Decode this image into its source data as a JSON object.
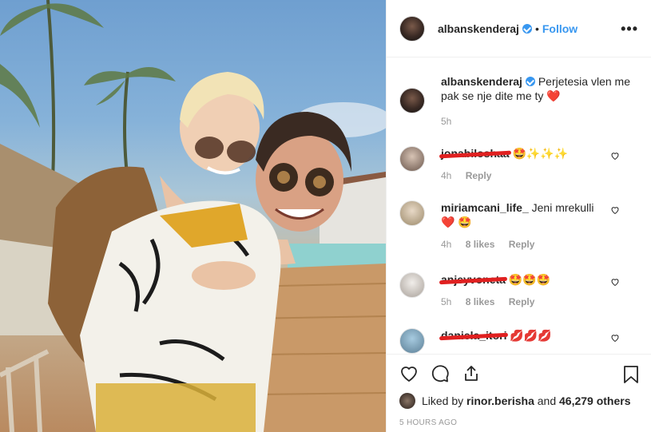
{
  "header": {
    "username": "albanskenderaj",
    "separator": "•",
    "follow_label": "Follow",
    "more_label": "•••"
  },
  "caption": {
    "username": "albanskenderaj",
    "text": "Perjetesia vlen me pak se nje dite me ty",
    "emoji": "❤️",
    "time": "5h"
  },
  "comments": [
    {
      "username": "jonabiloshaa",
      "text": "🤩✨✨✨",
      "time": "4h",
      "likes": "",
      "reply": "Reply",
      "struck": true
    },
    {
      "username": "miriamcani_life_",
      "text": "Jeni mrekulli❤️ 🤩",
      "time": "4h",
      "likes": "8 likes",
      "reply": "Reply",
      "struck": false
    },
    {
      "username": "anjeyvoneta",
      "text": "🤩🤩🤩",
      "time": "5h",
      "likes": "8 likes",
      "reply": "Reply",
      "struck": true
    },
    {
      "username": "daniela_itori",
      "text": "💋💋💋",
      "time": "",
      "likes": "",
      "reply": "",
      "struck": true
    }
  ],
  "likes_line": {
    "prefix": "Liked by",
    "user": "rinor.berisha",
    "middle": "and",
    "count": "46,279 others"
  },
  "timestamp": "5 HOURS AGO",
  "colors": {
    "link": "#3897f0",
    "muted": "#999999",
    "verified": "#3897f0",
    "redact": "#e02020"
  },
  "icons": [
    "heart-icon",
    "comment-icon",
    "share-icon",
    "bookmark-icon",
    "verified-badge-icon",
    "more-options-icon"
  ]
}
